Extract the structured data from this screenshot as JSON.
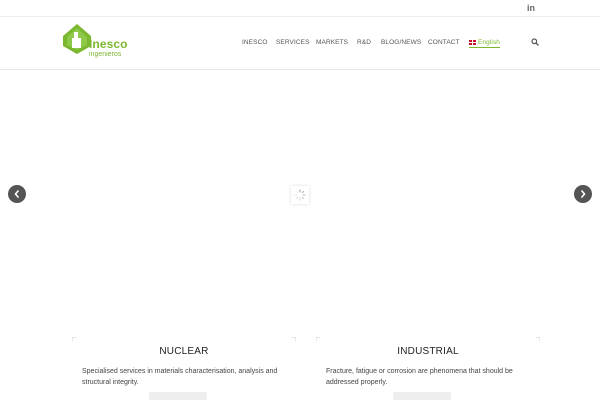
{
  "topbar": {
    "linkedin_label": "in"
  },
  "brand": {
    "name": "Inesco",
    "sub": "ingenieros",
    "color": "#7cb82f"
  },
  "nav": {
    "items": [
      "INESCO",
      "SERVICES",
      "MARKETS",
      "R&D",
      "BLOG/NEWS",
      "CONTACT"
    ],
    "language": "English"
  },
  "slider": {
    "loading": true
  },
  "cards": [
    {
      "title": "NUCLEAR",
      "text": "Specialised services in materials characterisation, analysis and structural integrity."
    },
    {
      "title": "INDUSTRIAL",
      "text": "Fracture, fatigue or corrosion are phenomena that should be addressed properly."
    }
  ],
  "icons": {
    "linkedin": "linkedin-icon",
    "search": "search-icon",
    "prev": "chevron-left-icon",
    "next": "chevron-right-icon",
    "loader": "loading-spinner-icon",
    "flag": "uk-flag-icon"
  }
}
